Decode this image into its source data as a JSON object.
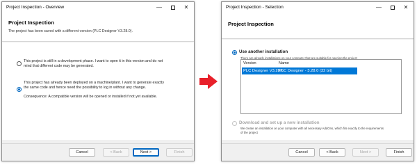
{
  "left": {
    "title": "Project Inspection - Overview",
    "header_title": "Project Inspection",
    "header_desc": "The project has been saved with a different version (PLC Designer V3.28.0).",
    "option1_line1": "This project is still in a development phase. I want to open it in this version and do not",
    "option1_line2": "mind that different code may be generated.",
    "option2_line1": "This project has already been deployed on a machine/plant. I want to generate exactly",
    "option2_line2": "the same code and hence need the possibility to log in without any change.",
    "consequence": "Consequence: A compatible version will be opened or installed if not yet available.",
    "buttons": {
      "cancel": "Cancel",
      "back": "< Back",
      "next": "Next >",
      "finish": "Finish"
    }
  },
  "right": {
    "title": "Project Inspection - Selection",
    "header_title": "Project Inspection",
    "use_another_label": "Use another installation",
    "use_another_desc": "There are already installations on your computer that are suitable for opening the project",
    "columns": [
      "Version",
      "Name"
    ],
    "rows": [
      {
        "version": "PLC Designer V3.28.0",
        "name": "PLC Designer - 3.28.0 (32 bit)"
      }
    ],
    "download_label": "Download and set up a new installation",
    "download_desc_line1": "We create an installation on your computer with all necessary AddOns, which fits exactly to the requirements",
    "download_desc_line2": "of the project",
    "buttons": {
      "cancel": "Cancel",
      "back": "< Back",
      "next": "Next >",
      "finish": "Finish"
    }
  },
  "window_controls": {
    "minimize": "—",
    "maximize": "",
    "close": "✕"
  },
  "colors": {
    "accent": "#0067c0",
    "selection": "#0078d7",
    "arrow": "#e8202a"
  }
}
